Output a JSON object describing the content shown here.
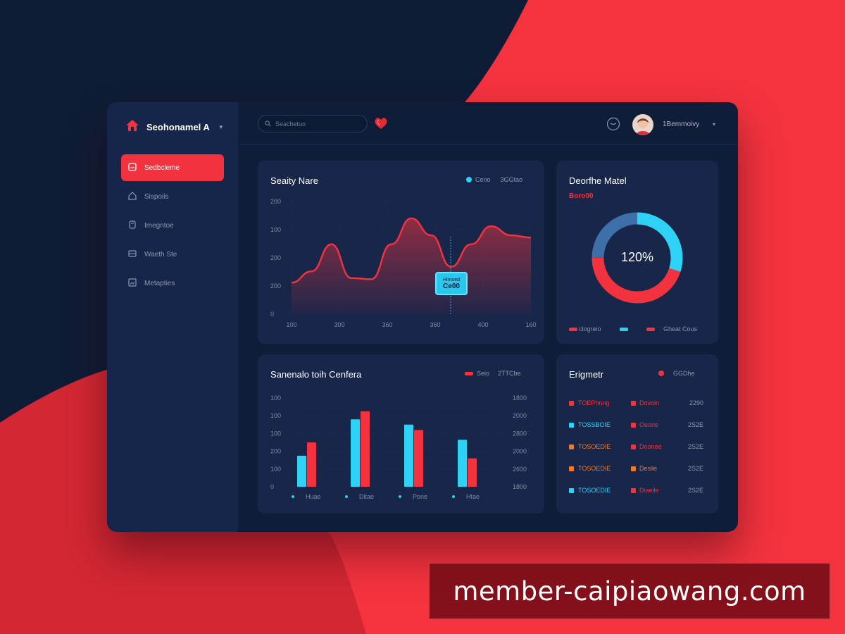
{
  "colors": {
    "accent_red": "#f2323e",
    "accent_cyan": "#2ed2f5",
    "accent_orange": "#f07a2c",
    "panel": "#172649",
    "background_navy": "#0f1c36"
  },
  "brand": {
    "name": "Seohonamel A",
    "icon": "home-icon"
  },
  "sidebar": {
    "items": [
      {
        "label": "Sedbcleme",
        "icon": "dashboard-icon",
        "active": true
      },
      {
        "label": "Sispoiis",
        "icon": "home-icon",
        "active": false
      },
      {
        "label": "Imegntoe",
        "icon": "document-icon",
        "active": false
      },
      {
        "label": "Waeth Ste",
        "icon": "inbox-icon",
        "active": false
      },
      {
        "label": "Metapties",
        "icon": "image-icon",
        "active": false
      }
    ]
  },
  "topbar": {
    "search_placeholder": "Seacbetuo",
    "username": "1Bemmoivy"
  },
  "sales_card": {
    "title": "Seaity Nare",
    "legend_label": "Ceno",
    "legend_value": "3GGtao",
    "tooltip_label": "Hlmoed",
    "tooltip_value": "Ce00"
  },
  "distribution_card": {
    "title": "Deorfhe Matel",
    "subtitle": "Boro00",
    "center_value": "120%",
    "legend": [
      "clogreio",
      "",
      "Gheat Cous"
    ]
  },
  "comparison_card": {
    "title": "Sanenalo toih Cenfera",
    "legend_label": "Seio",
    "legend_value": "2TTCbe",
    "categories": [
      "Huae",
      "Ditae",
      "Pone",
      "Htae"
    ]
  },
  "engagement_card": {
    "title": "Erigmetr",
    "legend_value": "GGDhe",
    "rows": [
      {
        "name": "TOEPhnng",
        "status": "Dovoin",
        "value": "2290",
        "color": "#f2323e",
        "status_color": "#f2323e"
      },
      {
        "name": "TOSSBOIE",
        "status": "Oeorie",
        "value": "2S2E",
        "color": "#2ed2f5",
        "status_color": "#f2323e"
      },
      {
        "name": "TOSOEDIE",
        "status": "Doonee",
        "value": "2S2E",
        "color": "#f07a2c",
        "status_color": "#f2323e"
      },
      {
        "name": "TOSOEDIE",
        "status": "Desile",
        "value": "2S2E",
        "color": "#f07a2c",
        "status_color": "#f07a2c"
      },
      {
        "name": "TOSOEDIE",
        "status": "Diaeile",
        "value": "2S2E",
        "color": "#2ed2f5",
        "status_color": "#f2323e"
      }
    ]
  },
  "chart_data": [
    {
      "type": "area",
      "title": "Seaity Nare",
      "x_tick_labels": [
        "100",
        "300",
        "360",
        "360",
        "400",
        "160"
      ],
      "y_tick_labels": [
        "200",
        "100",
        "200",
        "200",
        "0"
      ],
      "series": [
        {
          "values": [
            0.28,
            0.38,
            0.62,
            0.32,
            0.31,
            0.62,
            0.85,
            0.7,
            0.42,
            0.62,
            0.78,
            0.7,
            0.68
          ]
        }
      ],
      "annotation": {
        "label": "Hlmoed",
        "value": "Ce00"
      }
    },
    {
      "type": "pie",
      "title": "Deorfhe Matel",
      "center_label": "120%",
      "slices": [
        {
          "value": 0.3,
          "color": "#2ed2f5"
        },
        {
          "value": 0.45,
          "color": "#f2323e"
        },
        {
          "value": 0.25,
          "color": "#3d6fa8"
        }
      ]
    },
    {
      "type": "bar",
      "title": "Sanenalo toih Cenfera",
      "categories": [
        "Huae",
        "Ditae",
        "Pone",
        "Htae"
      ],
      "y_tick_labels": [
        "100",
        "100",
        "100",
        "200",
        "100",
        "0"
      ],
      "y2_tick_labels": [
        "1800",
        "2000",
        "2800",
        "2000",
        "2600",
        "1800"
      ],
      "series": [
        {
          "color": "#2ed2f5",
          "values": [
            35,
            76,
            70,
            53
          ]
        },
        {
          "color": "#f2323e",
          "values": [
            50,
            85,
            64,
            32
          ]
        }
      ],
      "ylim": [
        0,
        100
      ]
    }
  ]
}
